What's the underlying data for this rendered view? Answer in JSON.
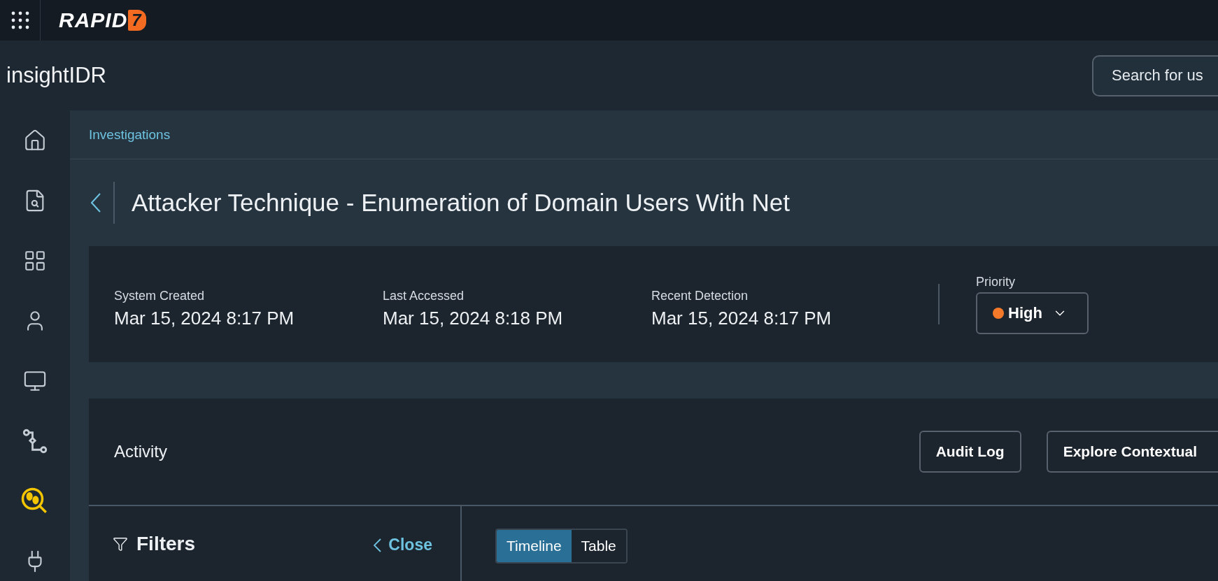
{
  "topbar": {
    "logo": {
      "text": "RAPID",
      "mark": "7"
    }
  },
  "header": {
    "product": "insightIDR",
    "search": {
      "placeholder": "Search for us"
    }
  },
  "nav": [
    {
      "selected": false
    },
    {
      "selected": false
    },
    {
      "selected": false
    },
    {
      "selected": false
    },
    {
      "selected": false
    },
    {
      "selected": false
    },
    {
      "selected": true
    },
    {
      "selected": false
    }
  ],
  "breadcrumb": "Investigations",
  "title": "Attacker Technique - Enumeration of Domain Users With Net",
  "details": [
    {
      "label": "System Created",
      "value": "Mar 15, 2024 8:17 PM"
    },
    {
      "label": "Last Accessed",
      "value": "Mar 15, 2024 8:18 PM"
    },
    {
      "label": "Recent Detection",
      "value": "Mar 15, 2024 8:17 PM"
    }
  ],
  "priority": {
    "label": "Priority",
    "value": "High",
    "color": "#f47a2a"
  },
  "activity": {
    "title": "Activity",
    "buttons": [
      "Audit Log",
      "Explore Contextual"
    ]
  },
  "filters": {
    "title": "Filters",
    "close": "Close"
  },
  "view_tabs": [
    {
      "label": "Timeline",
      "selected": true
    },
    {
      "label": "Table",
      "selected": false
    }
  ]
}
